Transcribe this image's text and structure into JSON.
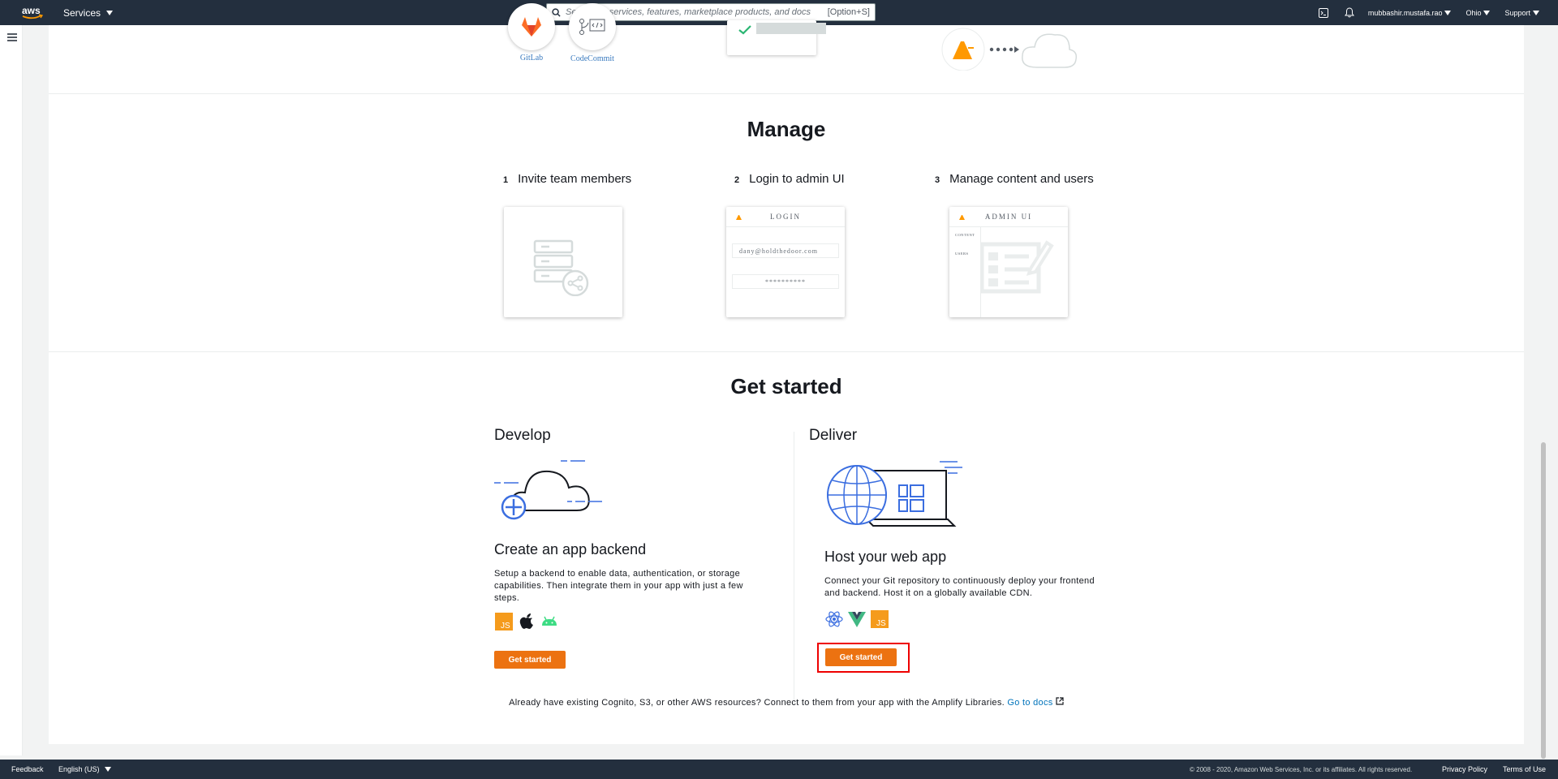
{
  "topnav": {
    "services_label": "Services",
    "search_placeholder": "Search for services, features, marketplace products, and docs",
    "search_shortcut": "[Option+S]",
    "account": "mubbashir.mustafa.rao",
    "region": "Ohio",
    "support": "Support"
  },
  "top_row": {
    "gitlab_label": "GitLab",
    "codecommit_label": "CodeCommit"
  },
  "manage": {
    "title": "Manage",
    "steps": [
      {
        "num": "1",
        "label": "Invite team members"
      },
      {
        "num": "2",
        "label": "Login to admin UI"
      },
      {
        "num": "3",
        "label": "Manage content and users"
      }
    ],
    "login_mock": {
      "title": "LOGIN",
      "email": "dany@holdthedoor.com",
      "password": "**********"
    },
    "admin_mock": {
      "title": "ADMIN UI",
      "content_label": "CONTENT",
      "users_label": "USERS"
    }
  },
  "get_started": {
    "title": "Get started",
    "develop": {
      "heading": "Develop",
      "subheading": "Create an app backend",
      "description": "Setup a backend to enable data, authentication, or storage capabilities. Then integrate them in your app with just a few steps.",
      "button": "Get started"
    },
    "deliver": {
      "heading": "Deliver",
      "subheading": "Host your web app",
      "description": "Connect your Git repository to continuously deploy your frontend and backend. Host it on a globally available CDN.",
      "button": "Get started"
    },
    "note_text": "Already have existing Cognito, S3, or other AWS resources? Connect to them from your app with the Amplify Libraries.",
    "docs_link": "Go to docs"
  },
  "footer": {
    "feedback": "Feedback",
    "language": "English (US)",
    "copyright": "© 2008 - 2020, Amazon Web Services, Inc. or its affiliates. All rights reserved.",
    "privacy": "Privacy Policy",
    "terms": "Terms of Use"
  },
  "colors": {
    "nav_bg": "#232f3e",
    "primary_button": "#ec7211",
    "link": "#0073bb",
    "highlight": "#ee0000"
  }
}
